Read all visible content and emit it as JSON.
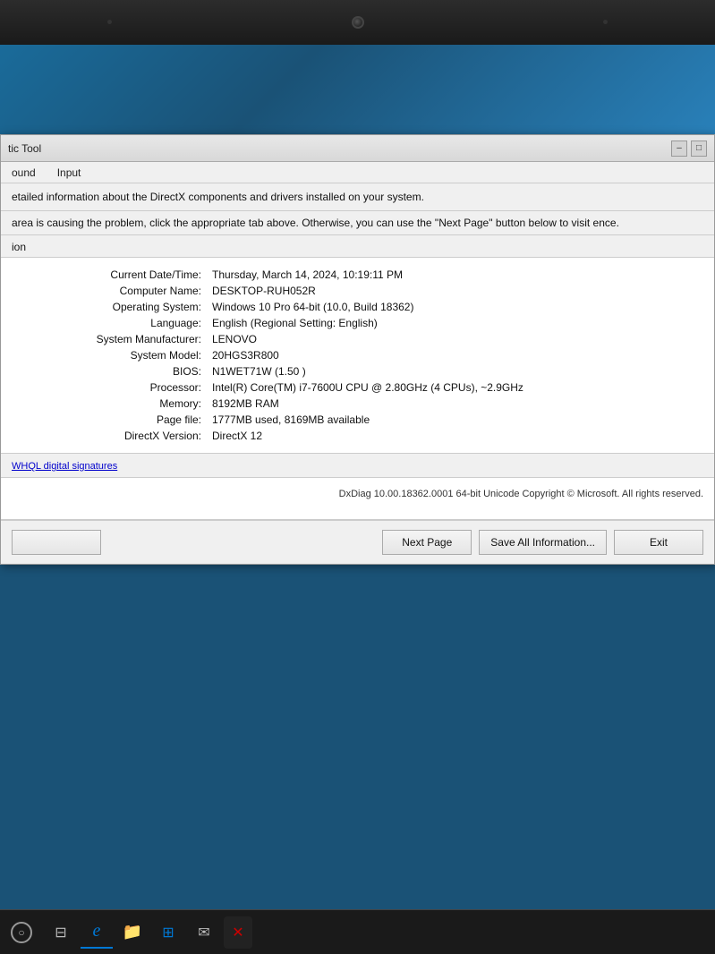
{
  "window": {
    "title": "DirectX Diagnostic Tool",
    "title_short": "tic Tool",
    "minimize_label": "–",
    "maximize_label": "□",
    "close_label": "✕"
  },
  "menu": {
    "items": [
      "ound",
      "Input"
    ]
  },
  "description": {
    "line1": "etailed information about the DirectX components and drivers installed on your system.",
    "line2": "area is causing the problem, click the appropriate tab above.  Otherwise, you can use the \"Next Page\" button below to visit ence."
  },
  "section": {
    "label": "ion"
  },
  "system_info": {
    "datetime_label": "Current Date/Time:",
    "datetime_value": "Thursday, March 14, 2024, 10:19:11 PM",
    "computer_label": "Computer Name:",
    "computer_value": "DESKTOP-RUH052R",
    "os_label": "Operating System:",
    "os_value": "Windows 10 Pro 64-bit (10.0, Build 18362)",
    "language_label": "Language:",
    "language_value": "English (Regional Setting: English)",
    "manufacturer_label": "System Manufacturer:",
    "manufacturer_value": "LENOVO",
    "model_label": "System Model:",
    "model_value": "20HGS3R800",
    "bios_label": "BIOS:",
    "bios_value": "N1WET71W (1.50 )",
    "processor_label": "Processor:",
    "processor_value": "Intel(R) Core(TM) i7-7600U CPU @ 2.80GHz (4 CPUs), ~2.9GHz",
    "memory_label": "Memory:",
    "memory_value": "8192MB RAM",
    "pagefile_label": "Page file:",
    "pagefile_value": "1777MB used, 8169MB available",
    "directx_label": "DirectX Version:",
    "directx_value": "DirectX 12"
  },
  "signature": {
    "link_text": "WHQL digital signatures"
  },
  "copyright": {
    "text": "DxDiag 10.00.18362.0001 64-bit Unicode  Copyright © Microsoft. All rights reserved."
  },
  "buttons": {
    "left_label": "",
    "next_page": "Next Page",
    "save_all": "Save All Information...",
    "exit": "Exit"
  },
  "taskbar": {
    "icons": [
      "○",
      "⊟",
      "e",
      "📁",
      "⊞",
      "✉",
      "✕"
    ]
  }
}
